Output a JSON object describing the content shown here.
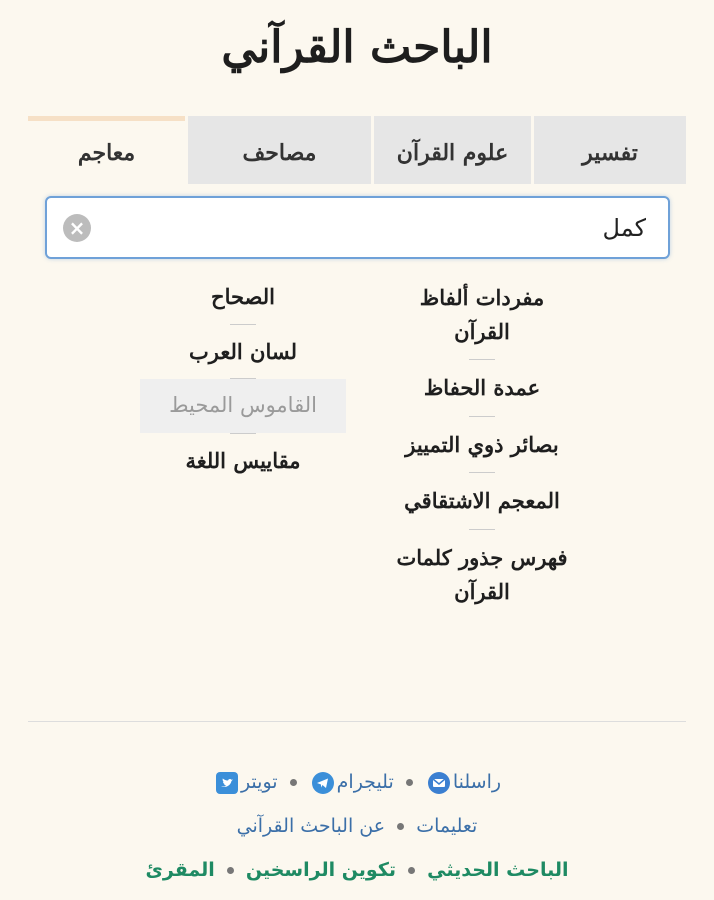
{
  "app": {
    "title": "الباحث القرآني"
  },
  "tabs": [
    {
      "label": "تفسير"
    },
    {
      "label": "علوم القرآن"
    },
    {
      "label": "مصاحف"
    },
    {
      "label": "معاجم",
      "active": true
    }
  ],
  "search": {
    "value": "كمل"
  },
  "dictionaries": {
    "right_column": [
      "مفردات ألفاظ القرآن",
      "عمدة الحفاظ",
      "بصائر ذوي التمييز",
      "المعجم الاشتقاقي",
      "فهرس جذور كلمات القرآن"
    ],
    "left_column": [
      "الصحاح",
      "لسان العرب",
      "القاموس المحيط",
      "مقاييس اللغة"
    ],
    "highlighted": "القاموس المحيط"
  },
  "footer": {
    "row1": {
      "contact": "راسلنا",
      "telegram": "تليجرام",
      "twitter": "تويتر"
    },
    "row2": {
      "instructions": "تعليمات",
      "about": "عن الباحث القرآني"
    },
    "row3": {
      "hadith": "الباحث الحديثي",
      "rasikhin": "تكوين الراسخين",
      "muqri": "المقرئ"
    }
  },
  "colors": {
    "background": "#fcf8ef",
    "link_blue": "#3b6fa8",
    "link_green": "#1e8a63",
    "search_border": "#6fa1d8",
    "active_tab_border": "#f6e0c6"
  },
  "icons": [
    "envelope-icon",
    "telegram-icon",
    "twitter-icon",
    "clear-icon"
  ]
}
